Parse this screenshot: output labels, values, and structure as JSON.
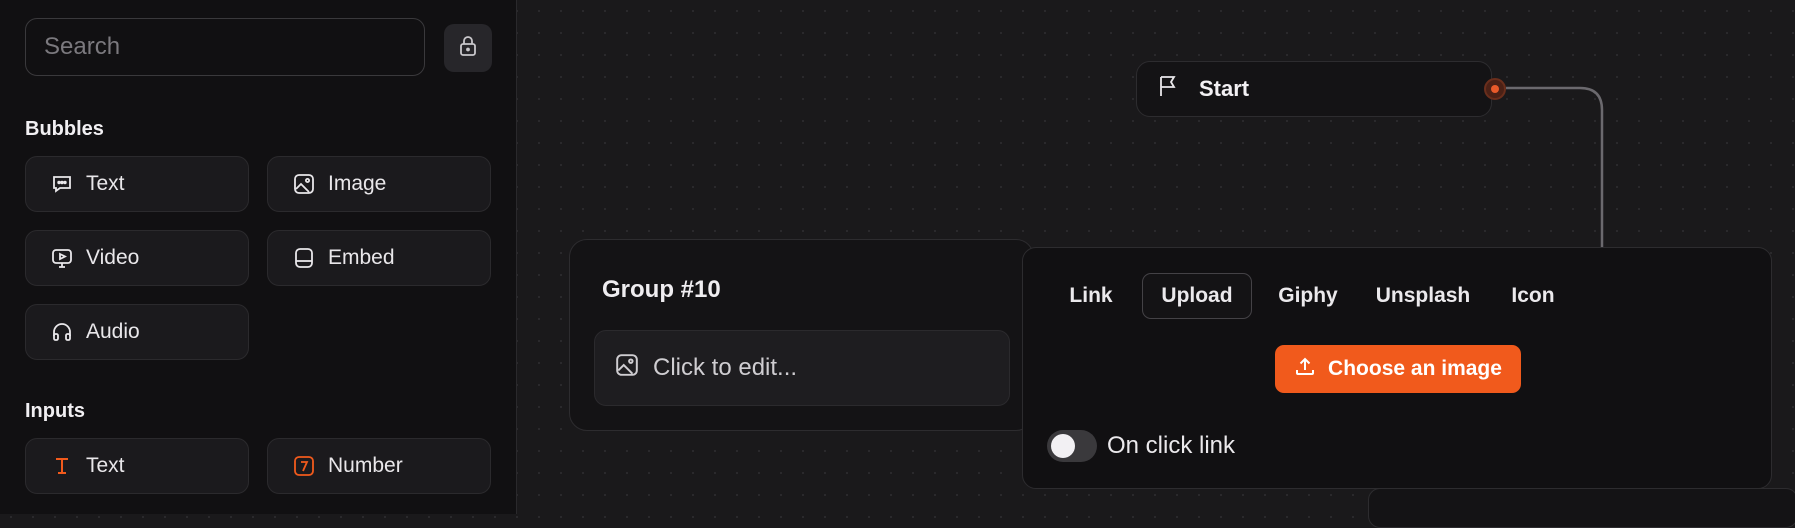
{
  "sidebar": {
    "search": {
      "placeholder": "Search"
    },
    "lock_icon": "lock-icon",
    "sections": {
      "bubbles": "Bubbles",
      "inputs": "Inputs"
    },
    "bubbles": {
      "text": {
        "label": "Text",
        "icon": "chat-bubble-icon"
      },
      "image": {
        "label": "Image",
        "icon": "image-icon"
      },
      "video": {
        "label": "Video",
        "icon": "video-icon"
      },
      "embed": {
        "label": "Embed",
        "icon": "embed-icon"
      },
      "audio": {
        "label": "Audio",
        "icon": "headphones-icon"
      }
    },
    "inputs": {
      "text": {
        "label": "Text",
        "icon": "text-cursor-icon",
        "color": "#f15a1c"
      },
      "number": {
        "label": "Number",
        "icon": "number-icon",
        "color": "#f15a1c"
      }
    }
  },
  "canvas": {
    "start_node": {
      "label": "Start",
      "icon": "flag-icon"
    },
    "group": {
      "title": "Group #10",
      "item": {
        "label": "Click to edit...",
        "icon": "image-icon"
      }
    }
  },
  "image_popover": {
    "tabs": {
      "link": "Link",
      "upload": "Upload",
      "giphy": "Giphy",
      "unsplash": "Unsplash",
      "icon": "Icon"
    },
    "active_tab": "Upload",
    "choose_button": "Choose an image",
    "toggle": {
      "label": "On click link",
      "on": false
    }
  },
  "colors": {
    "accent": "#f15a1c",
    "background": "#1a191b",
    "sidebar": "#111012"
  }
}
